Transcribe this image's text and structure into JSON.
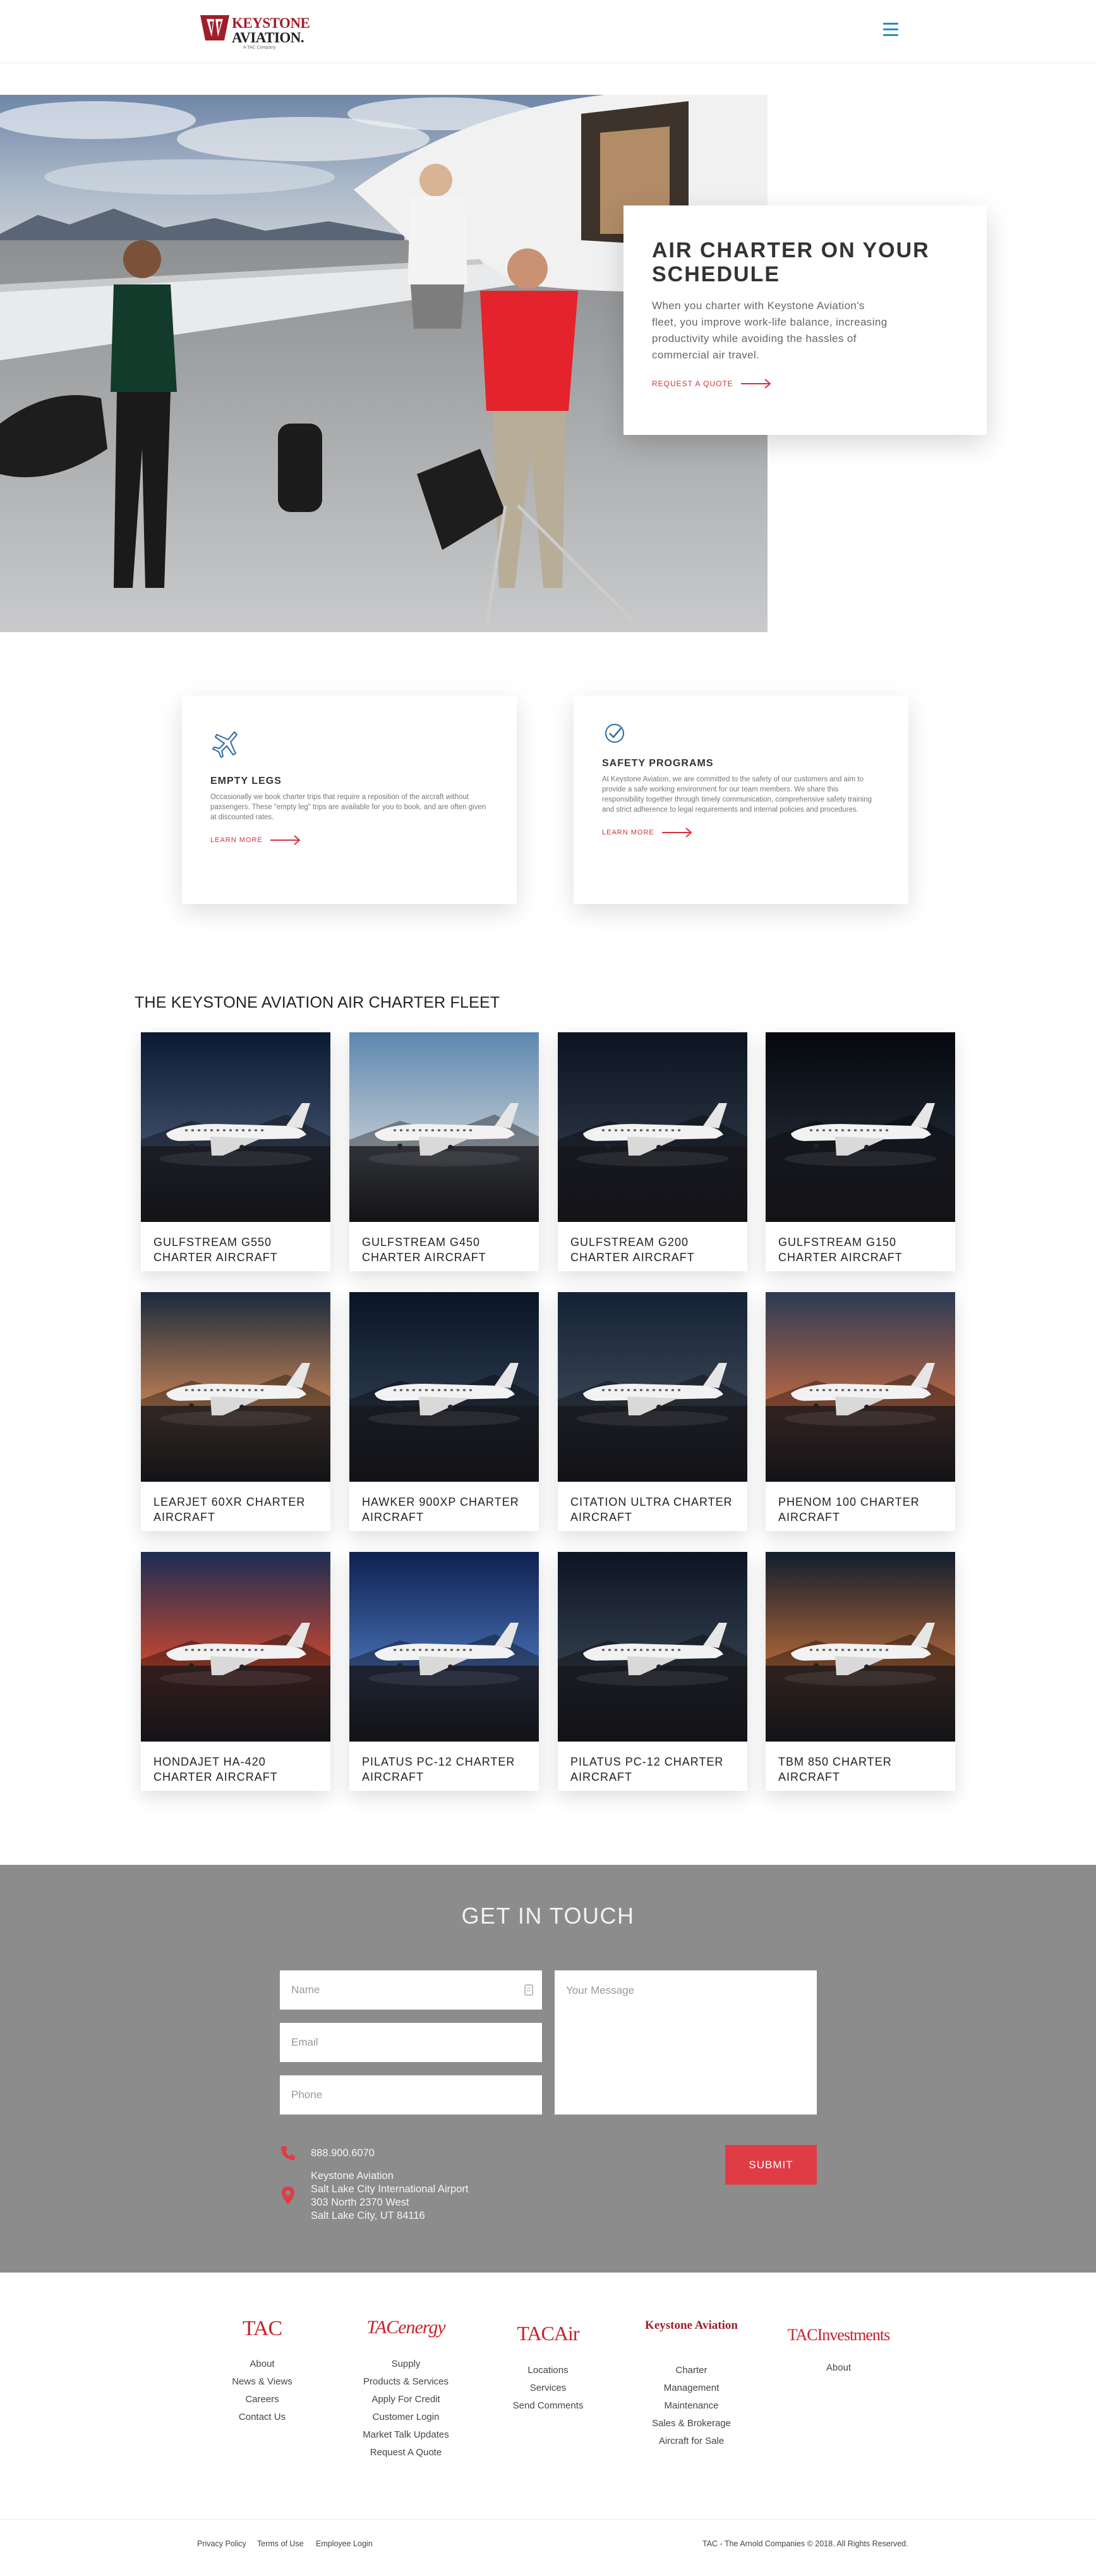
{
  "header": {
    "logo_line1": "Keystone",
    "logo_line2": "Aviation.",
    "logo_tagline": "A TAC Company",
    "menu_icon": "hamburger-menu-icon"
  },
  "hero": {
    "title": "Air Charter on Your Schedule",
    "text": "When you charter with Keystone Aviation's fleet, you improve work-life balance, increasing productivity while avoiding the hassles of commercial air travel.",
    "cta": "Request a Quote"
  },
  "features": [
    {
      "icon": "airplane-icon",
      "title": "Empty Legs",
      "text": "Occasionally we book charter trips that require a reposition of the aircraft without passengers. These \"empty leg\" trips are available for you to book, and are often given at discounted rates.",
      "cta": "Learn More"
    },
    {
      "icon": "shield-check-icon",
      "title": "Safety Programs",
      "text": "At Keystone Aviation, we are committed to the safety of our customers and aim to provide a safe working environment for our team members. We share this responsibility together through timely communication, comprehensive safety training and strict adherence to legal requirements and internal policies and procedures.",
      "cta": "Learn More"
    }
  ],
  "fleet": {
    "title": "The Keystone Aviation Air Charter Fleet",
    "items": [
      {
        "name": "Gulfstream G550 Charter Aircraft"
      },
      {
        "name": "Gulfstream G450 Charter Aircraft"
      },
      {
        "name": "Gulfstream G200 Charter Aircraft"
      },
      {
        "name": "Gulfstream G150 Charter Aircraft"
      },
      {
        "name": "Learjet 60XR Charter Aircraft"
      },
      {
        "name": "Hawker 900XP Charter Aircraft"
      },
      {
        "name": "Citation Ultra Charter Aircraft"
      },
      {
        "name": "Phenom 100 Charter Aircraft"
      },
      {
        "name": "HondaJet HA-420 Charter Aircraft"
      },
      {
        "name": "Pilatus PC-12 Charter Aircraft"
      },
      {
        "name": "Pilatus PC-12 Charter Aircraft"
      },
      {
        "name": "TBM 850 Charter Aircraft"
      }
    ]
  },
  "contact": {
    "title": "Get in Touch",
    "name_placeholder": "Name",
    "email_placeholder": "Email",
    "phone_placeholder": "Phone",
    "message_placeholder": "Your Message",
    "submit": "Submit",
    "phone": "888.900.6070",
    "address_lines": [
      "Keystone Aviation",
      "Salt Lake City International Airport",
      "303 North 2370 West",
      "Salt Lake City, UT 84116"
    ]
  },
  "footer": {
    "columns": [
      {
        "brand": "TAC",
        "links": [
          "About",
          "News & Views",
          "Careers",
          "Contact Us"
        ]
      },
      {
        "brand": "TACenergy",
        "links": [
          "Supply",
          "Products & Services",
          "Apply For Credit",
          "Customer Login",
          "Market Talk Updates",
          "Request A Quote"
        ]
      },
      {
        "brand": "TACAir",
        "links": [
          "Locations",
          "Services",
          "Send Comments"
        ]
      },
      {
        "brand": "Keystone Aviation",
        "links": [
          "Charter",
          "Management",
          "Maintenance",
          "Sales & Brokerage",
          "Aircraft for Sale"
        ]
      },
      {
        "brand": "TACInvestments",
        "links": [
          "About"
        ]
      }
    ],
    "bottom_links": [
      "Privacy Policy",
      "Terms of Use",
      "Employee Login"
    ],
    "copyright": "TAC - The Arnold Companies © 2018. All Rights Reserved."
  },
  "colors": {
    "accent_red": "#d1323a",
    "brand_red": "#a01e2a",
    "menu_blue": "#2e8bc0",
    "contact_bg": "#8c8c8c"
  }
}
